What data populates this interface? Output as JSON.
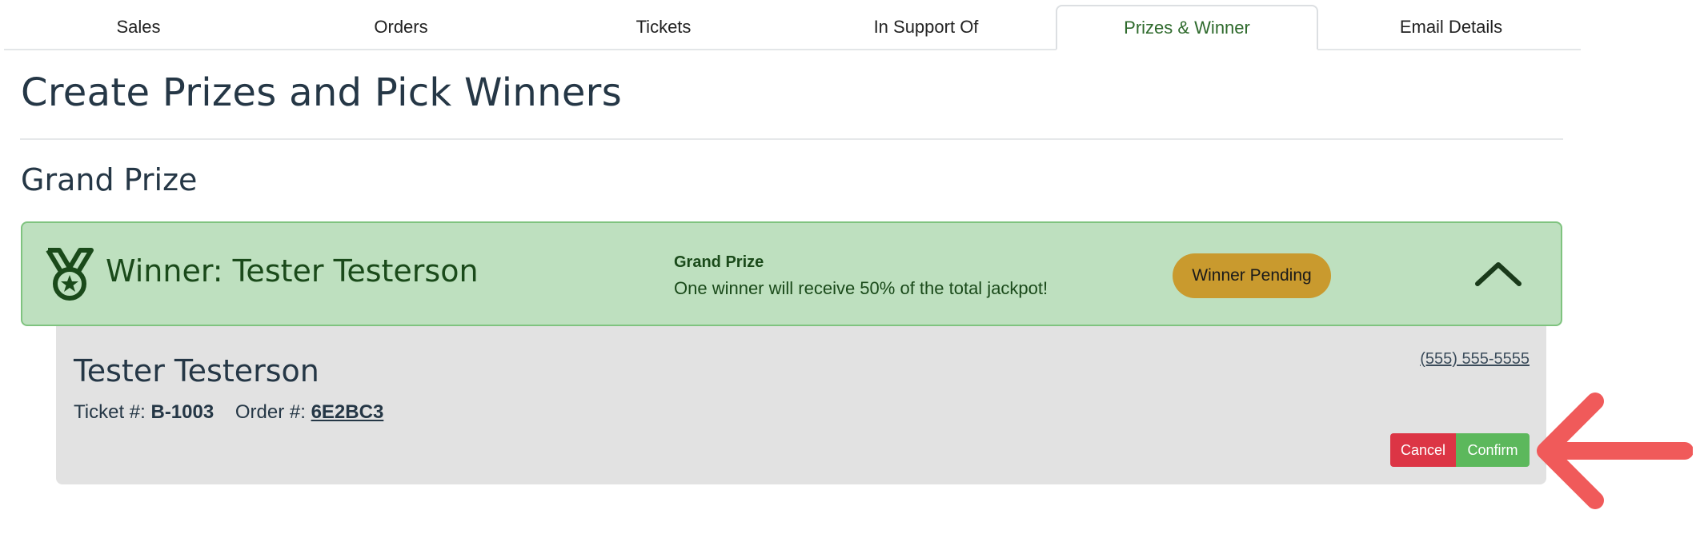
{
  "tabs": [
    {
      "label": "Sales"
    },
    {
      "label": "Orders"
    },
    {
      "label": "Tickets"
    },
    {
      "label": "In Support Of"
    },
    {
      "label": "Prizes & Winner"
    },
    {
      "label": "Email Details"
    }
  ],
  "active_tab": "Prizes & Winner",
  "page": {
    "title": "Create Prizes and Pick Winners",
    "section_title": "Grand Prize"
  },
  "prize": {
    "winner_heading": "Winner: Tester Testerson",
    "name": "Grand Prize",
    "description": "One winner will receive 50% of the total jackpot!",
    "status": "Winner Pending",
    "icon": "medal-icon",
    "colors": {
      "header_bg": "#bee0bf",
      "status_bg": "#c99a2e",
      "text": "#1a4a1a"
    }
  },
  "winner": {
    "name": "Tester Testerson",
    "ticket_label": "Ticket #:",
    "ticket_value": "B-1003",
    "order_label": "Order #:",
    "order_value": "6E2BC3",
    "phone": "(555) 555-5555"
  },
  "actions": {
    "cancel_label": "Cancel",
    "confirm_label": "Confirm",
    "colors": {
      "cancel": "#dc3545",
      "confirm": "#5cb85c"
    }
  },
  "annotation": {
    "icon": "arrow-left-icon",
    "color": "#f05a5a"
  }
}
